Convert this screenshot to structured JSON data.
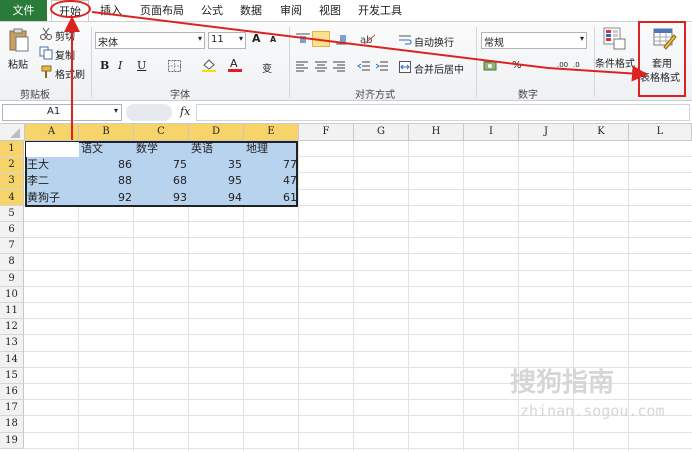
{
  "menu": {
    "file": "文件",
    "tabs": [
      "开始",
      "插入",
      "页面布局",
      "公式",
      "数据",
      "审阅",
      "视图",
      "开发工具"
    ]
  },
  "ribbon": {
    "clipboard": {
      "paste": "粘贴",
      "cut": "剪切",
      "copy": "复制",
      "format_painter": "格式刷",
      "label": "剪贴板"
    },
    "font": {
      "name": "宋体",
      "size": "11",
      "grow": "A",
      "shrink": "A",
      "bold": "B",
      "italic": "I",
      "underline": "U",
      "phonetic": "变",
      "label": "字体"
    },
    "alignment": {
      "wrap": "自动换行",
      "merge": "合并后居中",
      "label": "对齐方式"
    },
    "number": {
      "format": "常规",
      "percent": "%",
      "label": "数字"
    },
    "styles": {
      "conditional": "条件格式",
      "table_format_line1": "套用",
      "table_format_line2": "表格格式"
    }
  },
  "formula_bar": {
    "name_box": "A1",
    "fx": "fx",
    "value": ""
  },
  "columns": [
    "A",
    "B",
    "C",
    "D",
    "E",
    "F",
    "G",
    "H",
    "I",
    "J",
    "K",
    "L"
  ],
  "rows": [
    "1",
    "2",
    "3",
    "4",
    "5",
    "6",
    "7",
    "8",
    "9",
    "10",
    "11",
    "12",
    "13",
    "14",
    "15",
    "16",
    "17",
    "18",
    "19"
  ],
  "table": {
    "headers": [
      "",
      "语文",
      "数学",
      "英语",
      "地理"
    ],
    "data": [
      {
        "name": "王大",
        "values": [
          "86",
          "75",
          "35",
          "77"
        ]
      },
      {
        "name": "李二",
        "values": [
          "88",
          "68",
          "95",
          "47"
        ]
      },
      {
        "name": "黄狗子",
        "values": [
          "92",
          "93",
          "94",
          "61"
        ]
      }
    ]
  },
  "colors": {
    "file_tab": "#2a7a3a",
    "selection": "#b8d3ee",
    "header_selected": "#f6d46a",
    "annotation": "#dd2222"
  },
  "watermark": {
    "main": "搜狗指南",
    "sub": "zhinan.sogou.com"
  }
}
